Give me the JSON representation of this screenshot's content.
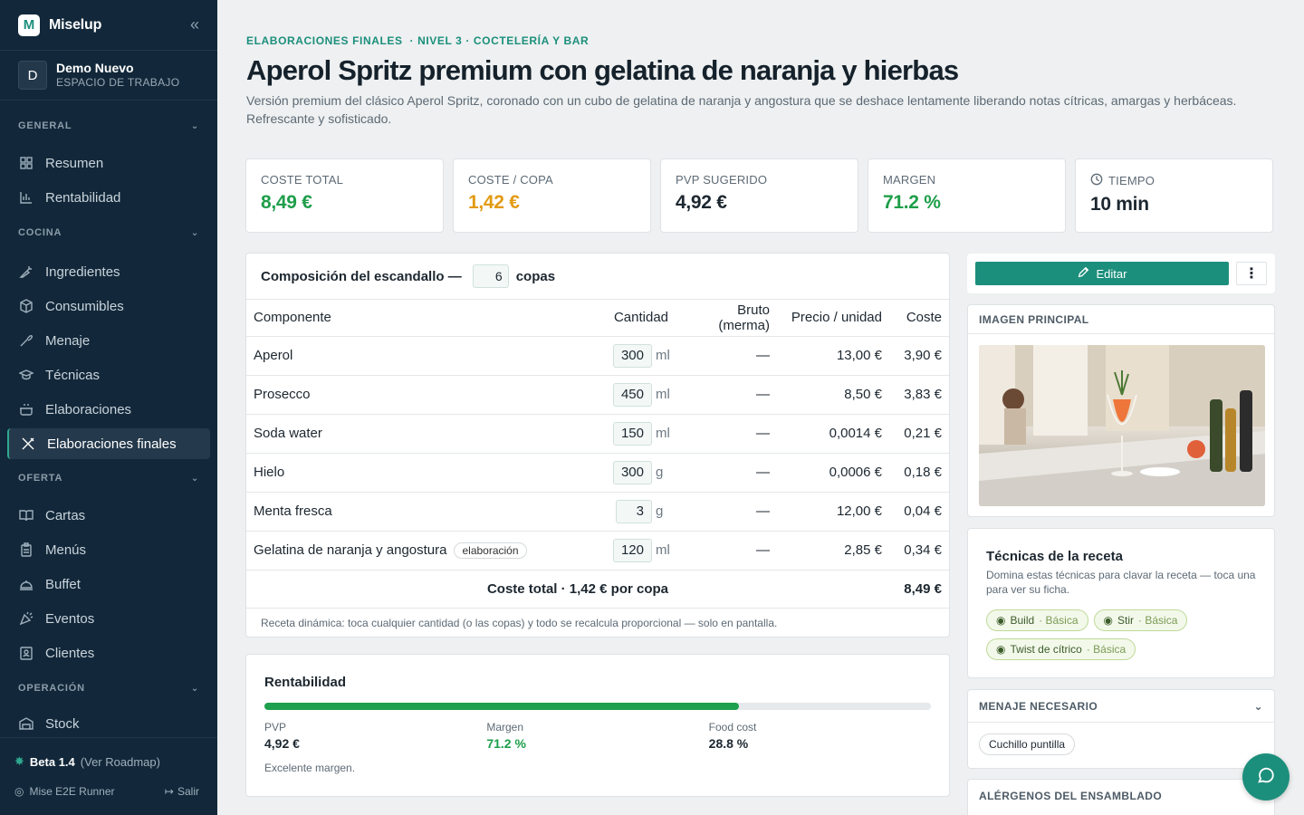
{
  "app": {
    "name": "Miselup",
    "logo_letter": "M"
  },
  "workspace": {
    "avatar": "D",
    "name": "Demo Nuevo",
    "subtitle": "ESPACIO DE TRABAJO"
  },
  "sidebar": {
    "sections": [
      {
        "title": "GENERAL",
        "items": [
          {
            "label": "Resumen",
            "icon": "grid-icon"
          },
          {
            "label": "Rentabilidad",
            "icon": "bar-chart-icon"
          }
        ]
      },
      {
        "title": "COCINA",
        "items": [
          {
            "label": "Ingredientes",
            "icon": "carrot-icon"
          },
          {
            "label": "Consumibles",
            "icon": "box-icon"
          },
          {
            "label": "Menaje",
            "icon": "utensil-icon"
          },
          {
            "label": "Técnicas",
            "icon": "graduation-icon"
          },
          {
            "label": "Elaboraciones",
            "icon": "pot-icon"
          },
          {
            "label": "Elaboraciones finales",
            "icon": "fork-knife-icon",
            "active": true
          }
        ]
      },
      {
        "title": "OFERTA",
        "items": [
          {
            "label": "Cartas",
            "icon": "book-icon"
          },
          {
            "label": "Menús",
            "icon": "clipboard-icon"
          },
          {
            "label": "Buffet",
            "icon": "cloche-icon"
          },
          {
            "label": "Eventos",
            "icon": "party-icon"
          },
          {
            "label": "Clientes",
            "icon": "contact-icon"
          }
        ]
      },
      {
        "title": "OPERACIÓN",
        "items": [
          {
            "label": "Stock",
            "icon": "warehouse-icon"
          }
        ]
      }
    ],
    "footer": {
      "beta": "Beta 1.4",
      "roadmap": "(Ver Roadmap)",
      "user": "Mise E2E Runner",
      "logout": "Salir"
    }
  },
  "breadcrumb": {
    "a": "ELABORACIONES FINALES",
    "b": "· NIVEL 3 · COCTELERÍA Y BAR"
  },
  "page": {
    "title": "Aperol Spritz premium con gelatina de naranja y hierbas",
    "description": "Versión premium del clásico Aperol Spritz, coronado con un cubo de gelatina de naranja y angostura que se deshace lentamente liberando notas cítricas, amargas y herbáceas. Refrescante y sofisticado."
  },
  "kpis": [
    {
      "label": "COSTE TOTAL",
      "value": "8,49 €",
      "color": "#1e9e4a"
    },
    {
      "label": "COSTE / COPA",
      "value": "1,42 €",
      "color": "#e39a12"
    },
    {
      "label": "PVP SUGERIDO",
      "value": "4,92 €",
      "color": "#15212b"
    },
    {
      "label": "MARGEN",
      "value": "71.2 %",
      "color": "#1e9e4a"
    },
    {
      "label": "TIEMPO",
      "value": "10 min",
      "color": "#15212b",
      "icon": "clock-icon"
    }
  ],
  "composition": {
    "title": "Composición del escandallo —",
    "copas": "6",
    "copas_label": "copas",
    "headers": {
      "component": "Componente",
      "qty": "Cantidad",
      "gross": "Bruto (merma)",
      "price": "Precio / unidad",
      "cost": "Coste"
    },
    "rows": [
      {
        "name": "Aperol",
        "qty": "300",
        "unit": "ml",
        "gross": "—",
        "price": "13,00 €",
        "cost": "3,90 €"
      },
      {
        "name": "Prosecco",
        "qty": "450",
        "unit": "ml",
        "gross": "—",
        "price": "8,50 €",
        "cost": "3,83 €"
      },
      {
        "name": "Soda water",
        "qty": "150",
        "unit": "ml",
        "gross": "—",
        "price": "0,0014 €",
        "cost": "0,21 €"
      },
      {
        "name": "Hielo",
        "qty": "300",
        "unit": "g",
        "gross": "—",
        "price": "0,0006 €",
        "cost": "0,18 €"
      },
      {
        "name": "Menta fresca",
        "qty": "3",
        "unit": "g",
        "gross": "—",
        "price": "12,00 €",
        "cost": "0,04 €"
      },
      {
        "name": "Gelatina de naranja y angostura",
        "tag": "elaboración",
        "qty": "120",
        "unit": "ml",
        "gross": "—",
        "price": "2,85 €",
        "cost": "0,34 €"
      }
    ],
    "total_label": "Coste total · 1,42 € por copa",
    "total_value": "8,49 €",
    "note": "Receta dinámica: toca cualquier cantidad (o las copas) y todo se recalcula proporcional — solo en pantalla."
  },
  "profitability": {
    "title": "Rentabilidad",
    "margin_fraction": 0.712,
    "pvp_label": "PVP",
    "pvp": "4,92 €",
    "margin_label": "Margen",
    "margin": "71.2 %",
    "foodcost_label": "Food cost",
    "foodcost": "28.8 %",
    "note": "Excelente margen.",
    "bar_color": "#1ea04e"
  },
  "actions": {
    "edit": "Editar"
  },
  "image_panel": {
    "title": "IMAGEN PRINCIPAL"
  },
  "techniques": {
    "title": "Técnicas de la receta",
    "subtitle": "Domina estas técnicas para clavar la receta — toca una para ver su ficha.",
    "items": [
      {
        "name": "Build",
        "level": "· Básica"
      },
      {
        "name": "Stir",
        "level": "· Básica"
      },
      {
        "name": "Twist de cítrico",
        "level": "· Básica"
      }
    ]
  },
  "utensils": {
    "title": "MENAJE NECESARIO",
    "items": [
      "Cuchillo puntilla"
    ]
  },
  "allergens": {
    "title": "ALÉRGENOS DEL ENSAMBLADO"
  },
  "colors": {
    "accent": "#1c8f7c",
    "sidebar_bg": "#12283a"
  }
}
